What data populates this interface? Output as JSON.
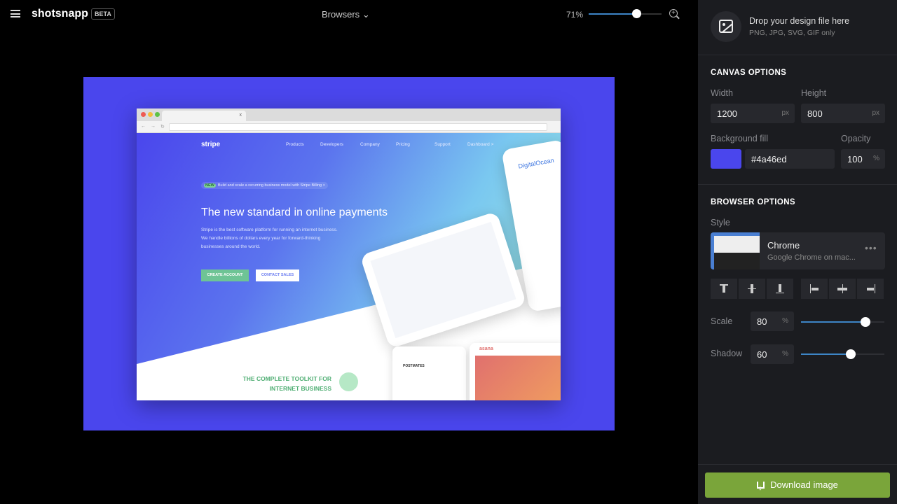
{
  "app": {
    "name": "shotsnapp",
    "badge": "BETA"
  },
  "header": {
    "device_menu": "Browsers",
    "zoom_label": "71%",
    "zoom_percent": 71,
    "zoom_slider_fraction": 0.65
  },
  "canvas": {
    "background": "#4a46ed",
    "browser": {
      "tab_close": "x",
      "site": {
        "logo": "stripe",
        "nav": [
          "Products",
          "Developers",
          "Company",
          "Pricing",
          "Support",
          "Dashboard >"
        ],
        "badge": "NEW",
        "announcement": "Build and scale a recurring business model with Stripe Billing >",
        "headline": "The new standard in online payments",
        "body": "Stripe is the best software platform for running an internet business. We handle billions of dollars every year for forward-thinking businesses around the world.",
        "cta_primary": "CREATE ACCOUNT",
        "cta_secondary": "CONTACT SALES",
        "toolkit": "THE COMPLETE TOOLKIT FOR INTERNET BUSINESS",
        "phone_brand": "DigitalOcean",
        "card_brand_1": "POSTMATES",
        "card_brand_2": "asana"
      }
    }
  },
  "sidebar": {
    "drop": {
      "title": "Drop your design file here",
      "subtitle": "PNG, JPG, SVG, GIF only"
    },
    "canvas_options": {
      "heading": "CANVAS OPTIONS",
      "width_label": "Width",
      "width_value": "1200",
      "width_unit": "px",
      "height_label": "Height",
      "height_value": "800",
      "height_unit": "px",
      "bg_label": "Background fill",
      "bg_value": "#4a46ed",
      "opacity_label": "Opacity",
      "opacity_value": "100",
      "opacity_unit": "%"
    },
    "browser_options": {
      "heading": "BROWSER OPTIONS",
      "style_label": "Style",
      "style_name": "Chrome",
      "style_desc": "Google Chrome on mac...",
      "more": "•••",
      "scale_label": "Scale",
      "scale_value": "80",
      "scale_unit": "%",
      "shadow_label": "Shadow",
      "shadow_value": "60",
      "shadow_unit": "%"
    },
    "download_label": "Download image",
    "accent": "#3d85c6",
    "download_color": "#7aa53a"
  }
}
